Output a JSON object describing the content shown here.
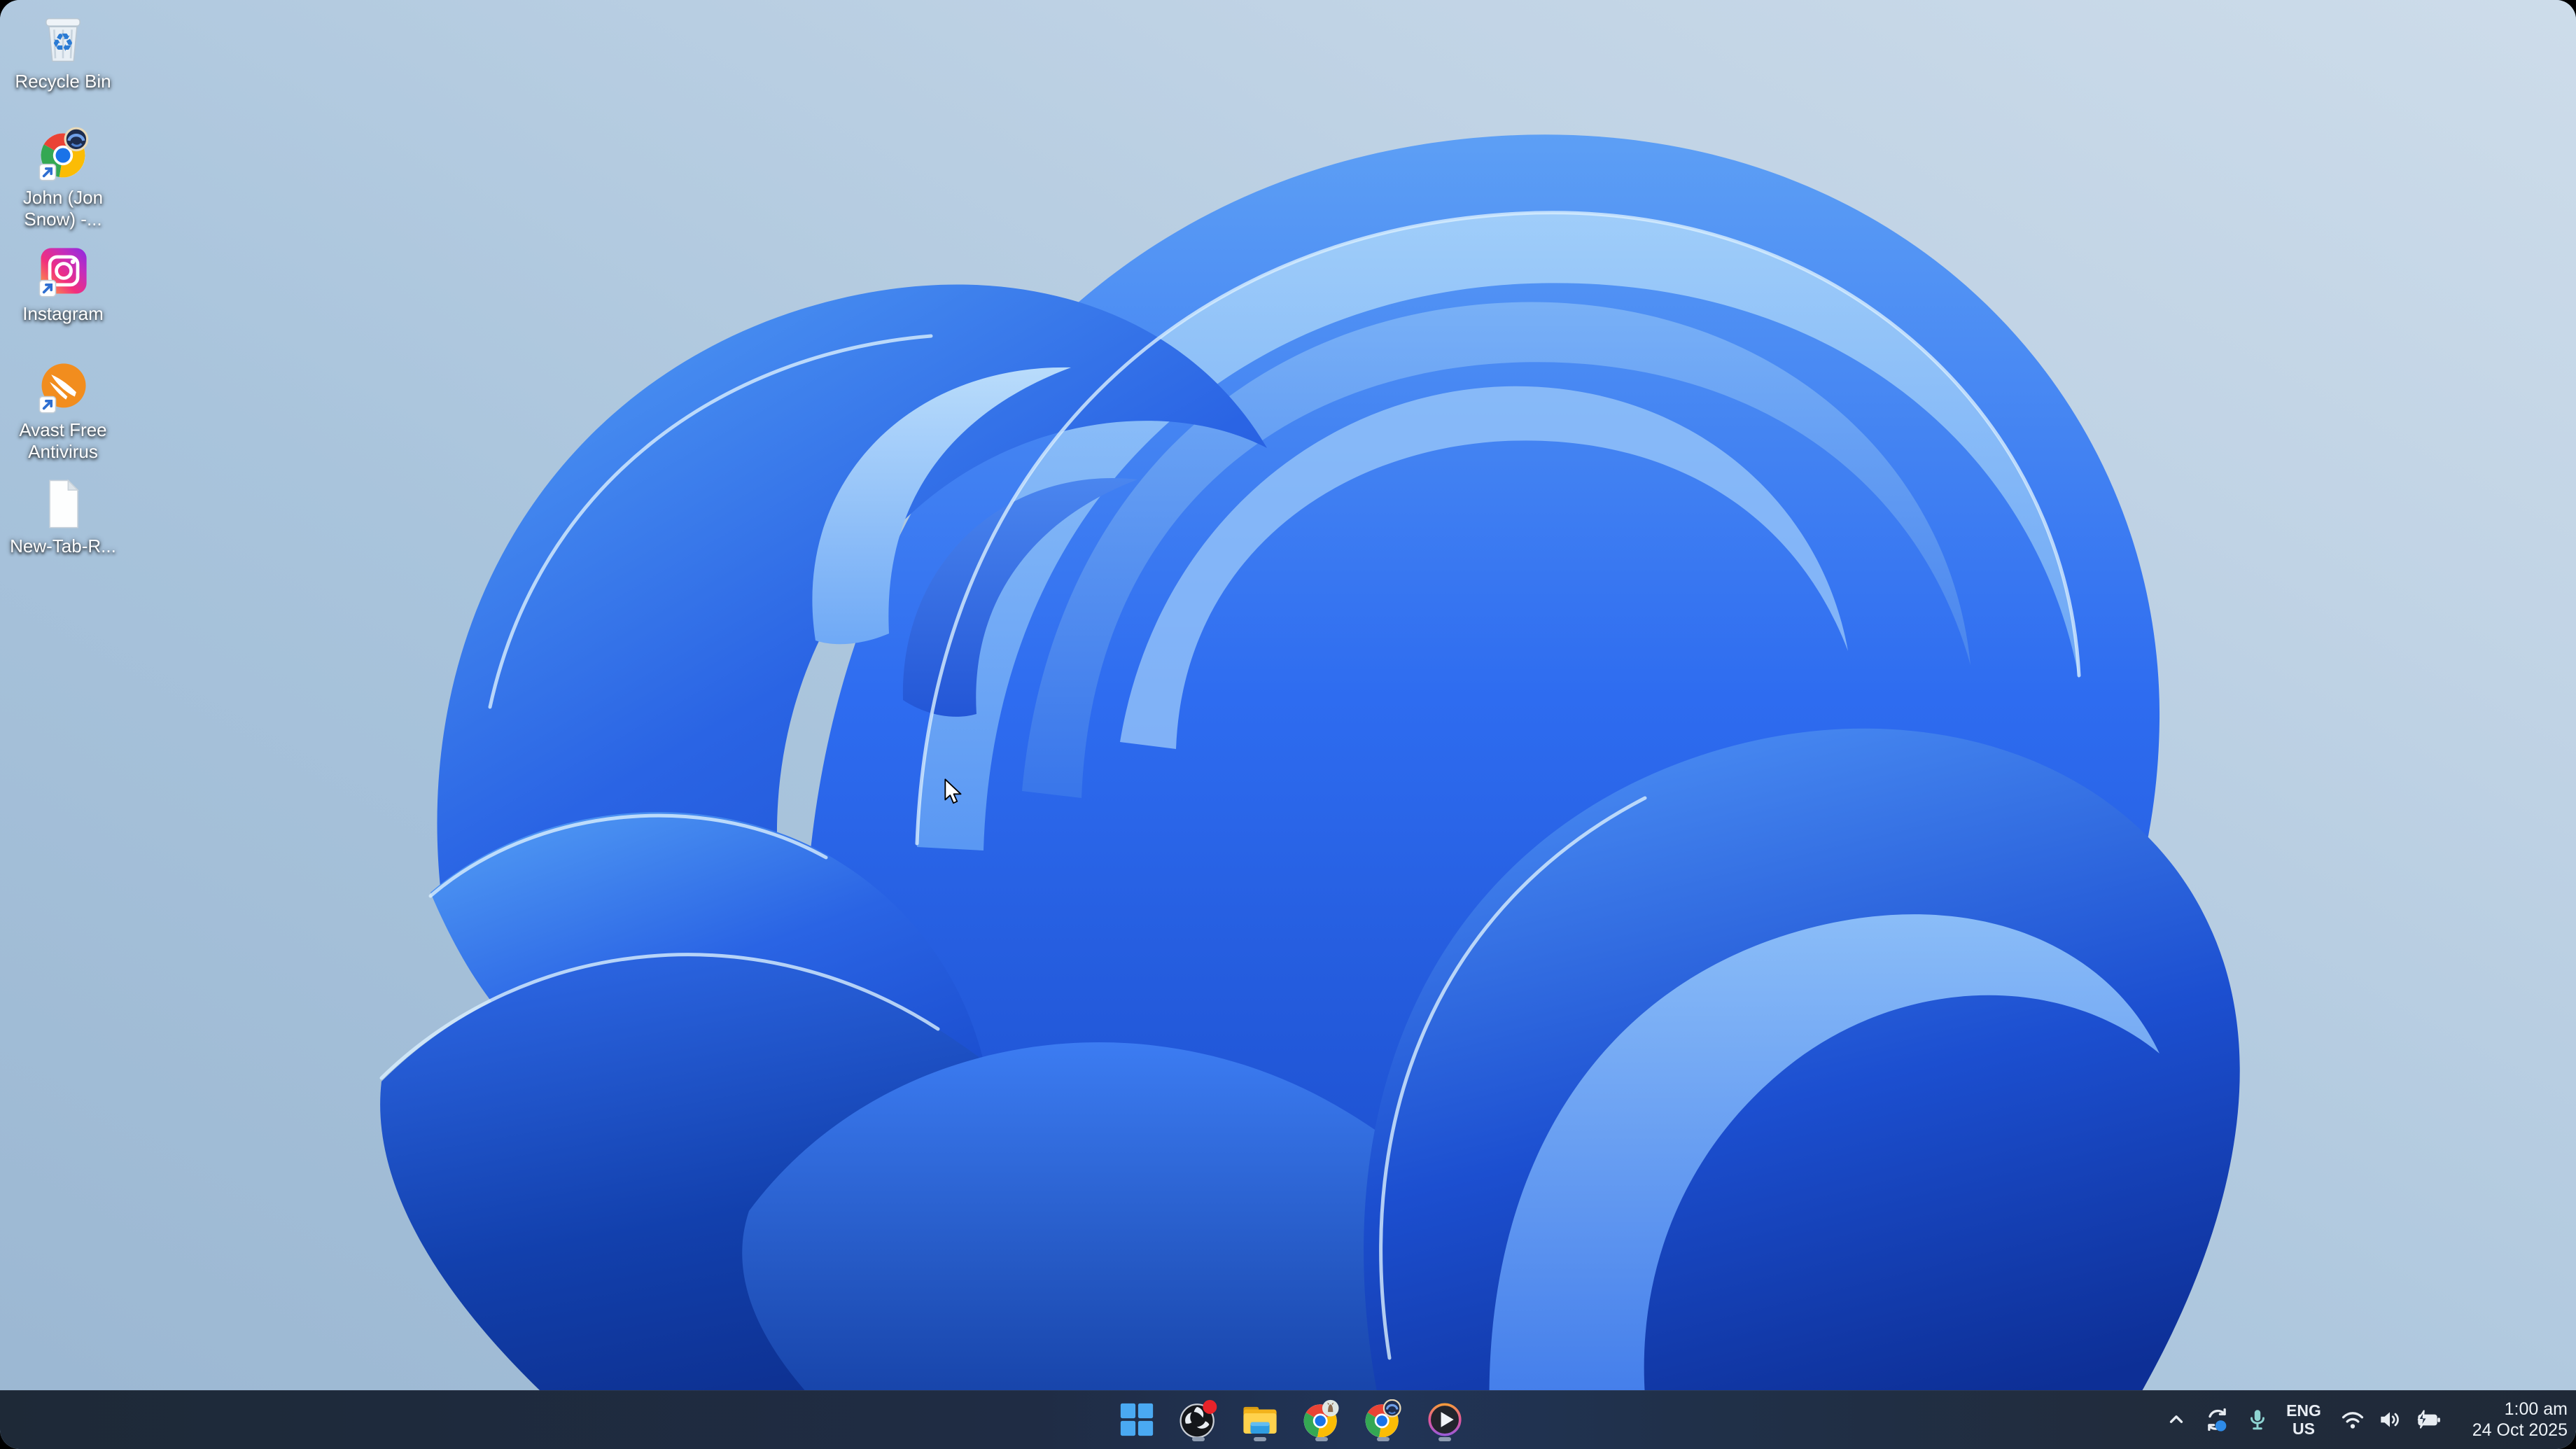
{
  "wallpaper": {
    "name": "windows-11-bloom",
    "background_light": "#c6d8e8",
    "background_mid": "#a9c4dc",
    "bloom_blue": "#2e6cf0",
    "bloom_dark": "#0d2f96"
  },
  "desktop": {
    "items": [
      {
        "name": "recycle-bin",
        "label": "Recycle Bin"
      },
      {
        "name": "chrome-profile-shortcut",
        "label": "John (Jon Snow) -..."
      },
      {
        "name": "instagram-shortcut",
        "label": "Instagram"
      },
      {
        "name": "avast-free-antivirus-shortcut",
        "label": "Avast Free Antivirus"
      },
      {
        "name": "new-tab-document",
        "label": "New-Tab-R..."
      }
    ]
  },
  "taskbar": {
    "apps": [
      {
        "name": "start",
        "running": false,
        "notification": false
      },
      {
        "name": "obs-studio",
        "running": true,
        "notification": true
      },
      {
        "name": "file-explorer",
        "running": true,
        "notification": false
      },
      {
        "name": "chrome-profile-1",
        "running": true,
        "notification": false
      },
      {
        "name": "chrome-profile-2",
        "running": true,
        "notification": false
      },
      {
        "name": "media-player",
        "running": true,
        "notification": false
      }
    ],
    "tray": {
      "language": {
        "line1": "ENG",
        "line2": "US"
      },
      "clock": {
        "time": "1:00 am",
        "date": "24 Oct 2025"
      }
    }
  },
  "colors": {
    "taskbar": "#202c42",
    "start_blue": "#4aa9f2",
    "notification_red": "#e8232a",
    "mic_teal": "#8ed4d2",
    "sync_dot_blue": "#2e8be8",
    "running_pill": "#8d9bb0"
  }
}
